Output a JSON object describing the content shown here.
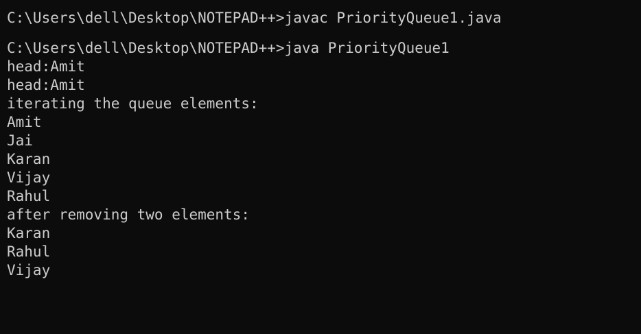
{
  "console": {
    "lines": [
      "C:\\Users\\dell\\Desktop\\NOTEPAD++>javac PriorityQueue1.java",
      "",
      "C:\\Users\\dell\\Desktop\\NOTEPAD++>java PriorityQueue1",
      "head:Amit",
      "head:Amit",
      "iterating the queue elements:",
      "Amit",
      "Jai",
      "Karan",
      "Vijay",
      "Rahul",
      "after removing two elements:",
      "Karan",
      "Rahul",
      "Vijay"
    ]
  },
  "colors": {
    "background": "#0c0c0c",
    "text": "#cccccc"
  }
}
